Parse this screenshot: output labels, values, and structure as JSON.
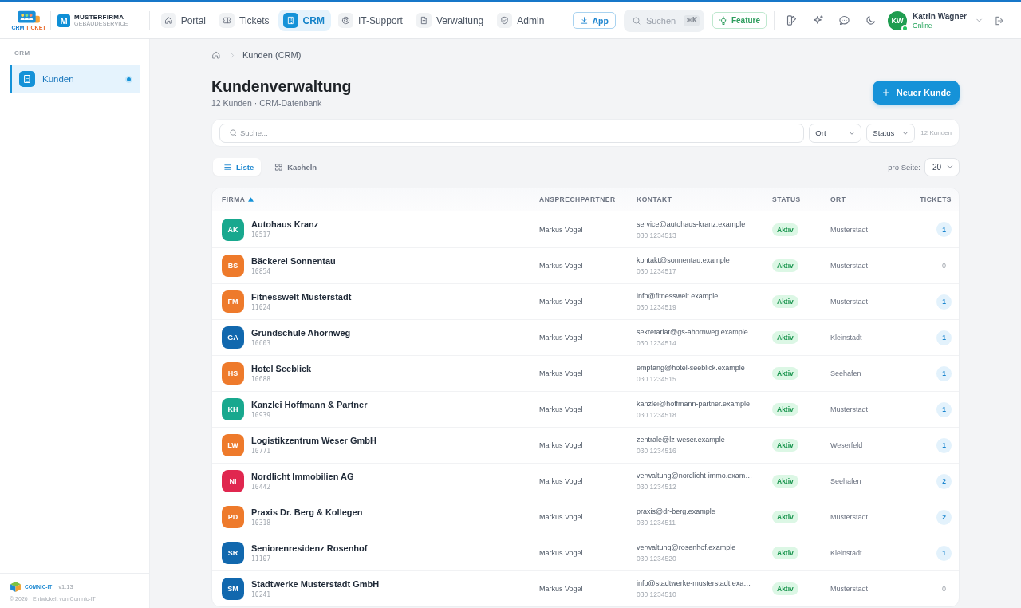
{
  "topbar": {
    "brand": {
      "primary": "CRM",
      "secondary": "TICKET"
    },
    "company": {
      "initial": "M",
      "name": "MUSTERFIRMA",
      "subtitle": "GEBÄUDESERVICE"
    },
    "nav": [
      {
        "label": "Portal",
        "selected": false
      },
      {
        "label": "Tickets",
        "selected": false
      },
      {
        "label": "CRM",
        "selected": true
      },
      {
        "label": "IT-Support",
        "selected": false
      },
      {
        "label": "Verwaltung",
        "selected": false
      },
      {
        "label": "Admin",
        "selected": false
      }
    ],
    "app_button": "App",
    "search": {
      "placeholder": "Suchen",
      "shortcut": "⌘K"
    },
    "feature_button": "Feature",
    "user": {
      "initials": "KW",
      "name": "Katrin Wagner",
      "status": "Online",
      "online": true
    }
  },
  "sidebar": {
    "section": "CRM",
    "items": [
      {
        "label": "Kunden",
        "selected": true
      }
    ],
    "footer": {
      "brand": "COMNIC-IT",
      "version": "v1.13",
      "copyright": "© 2026 · Entwickelt von Comnic-IT"
    }
  },
  "page": {
    "breadcrumb": {
      "current": "Kunden (CRM)"
    },
    "title": "Kundenverwaltung",
    "subtitle": "12 Kunden · CRM-Datenbank",
    "new_button": "Neuer Kunde"
  },
  "filters": {
    "search": {
      "placeholder": "Suche..."
    },
    "selects": [
      {
        "label": "Ort"
      },
      {
        "label": "Status"
      }
    ],
    "count": "12 Kunden"
  },
  "view": {
    "modes": [
      {
        "label": "Liste",
        "selected": true
      },
      {
        "label": "Kacheln",
        "selected": false
      }
    ],
    "page_size": {
      "label": "pro Seite:",
      "value": "20"
    }
  },
  "table": {
    "columns": [
      {
        "label": "FIRMA",
        "sorted": true
      },
      {
        "label": "ANSPRECHPARTNER",
        "sorted": false
      },
      {
        "label": "KONTAKT",
        "sorted": false
      },
      {
        "label": "STATUS",
        "sorted": false
      },
      {
        "label": "ORT",
        "sorted": false
      },
      {
        "label": "TICKETS",
        "sorted": false
      }
    ],
    "rows": [
      {
        "initials": "AK",
        "color": "#18a88e",
        "name": "Autohaus Kranz",
        "number": "10517",
        "contact_person": "Markus Vogel",
        "email": "service@autohaus-kranz.example",
        "phone": "030 1234513",
        "status": "Aktiv",
        "city": "Musterstadt",
        "tickets": "1",
        "tickets_badge": true
      },
      {
        "initials": "BS",
        "color": "#ee7a2b",
        "name": "Bäckerei Sonnentau",
        "number": "10854",
        "contact_person": "Markus Vogel",
        "email": "kontakt@sonnentau.example",
        "phone": "030 1234517",
        "status": "Aktiv",
        "city": "Musterstadt",
        "tickets": "0",
        "tickets_badge": false
      },
      {
        "initials": "FM",
        "color": "#ee7a2b",
        "name": "Fitnesswelt Musterstadt",
        "number": "11024",
        "contact_person": "Markus Vogel",
        "email": "info@fitnesswelt.example",
        "phone": "030 1234519",
        "status": "Aktiv",
        "city": "Musterstadt",
        "tickets": "1",
        "tickets_badge": true
      },
      {
        "initials": "GA",
        "color": "#1168ae",
        "name": "Grundschule Ahornweg",
        "number": "10603",
        "contact_person": "Markus Vogel",
        "email": "sekretariat@gs-ahornweg.example",
        "phone": "030 1234514",
        "status": "Aktiv",
        "city": "Kleinstadt",
        "tickets": "1",
        "tickets_badge": true
      },
      {
        "initials": "HS",
        "color": "#ee7a2b",
        "name": "Hotel Seeblick",
        "number": "10688",
        "contact_person": "Markus Vogel",
        "email": "empfang@hotel-seeblick.example",
        "phone": "030 1234515",
        "status": "Aktiv",
        "city": "Seehafen",
        "tickets": "1",
        "tickets_badge": true
      },
      {
        "initials": "KH",
        "color": "#18a88e",
        "name": "Kanzlei Hoffmann & Partner",
        "number": "10939",
        "contact_person": "Markus Vogel",
        "email": "kanzlei@hoffmann-partner.example",
        "phone": "030 1234518",
        "status": "Aktiv",
        "city": "Musterstadt",
        "tickets": "1",
        "tickets_badge": true
      },
      {
        "initials": "LW",
        "color": "#ee7a2b",
        "name": "Logistikzentrum Weser GmbH",
        "number": "10771",
        "contact_person": "Markus Vogel",
        "email": "zentrale@lz-weser.example",
        "phone": "030 1234516",
        "status": "Aktiv",
        "city": "Weserfeld",
        "tickets": "1",
        "tickets_badge": true
      },
      {
        "initials": "NI",
        "color": "#e0274f",
        "name": "Nordlicht Immobilien AG",
        "number": "10442",
        "contact_person": "Markus Vogel",
        "email": "verwaltung@nordlicht-immo.exam…",
        "phone": "030 1234512",
        "status": "Aktiv",
        "city": "Seehafen",
        "tickets": "2",
        "tickets_badge": true
      },
      {
        "initials": "PD",
        "color": "#ee7a2b",
        "name": "Praxis Dr. Berg & Kollegen",
        "number": "10318",
        "contact_person": "Markus Vogel",
        "email": "praxis@dr-berg.example",
        "phone": "030 1234511",
        "status": "Aktiv",
        "city": "Musterstadt",
        "tickets": "2",
        "tickets_badge": true
      },
      {
        "initials": "SR",
        "color": "#1168ae",
        "name": "Seniorenresidenz Rosenhof",
        "number": "11107",
        "contact_person": "Markus Vogel",
        "email": "verwaltung@rosenhof.example",
        "phone": "030 1234520",
        "status": "Aktiv",
        "city": "Kleinstadt",
        "tickets": "1",
        "tickets_badge": true
      },
      {
        "initials": "SM",
        "color": "#1168ae",
        "name": "Stadtwerke Musterstadt GmbH",
        "number": "10241",
        "contact_person": "Markus Vogel",
        "email": "info@stadtwerke-musterstadt.exa…",
        "phone": "030 1234510",
        "status": "Aktiv",
        "city": "Musterstadt",
        "tickets": "0",
        "tickets_badge": false
      }
    ]
  }
}
